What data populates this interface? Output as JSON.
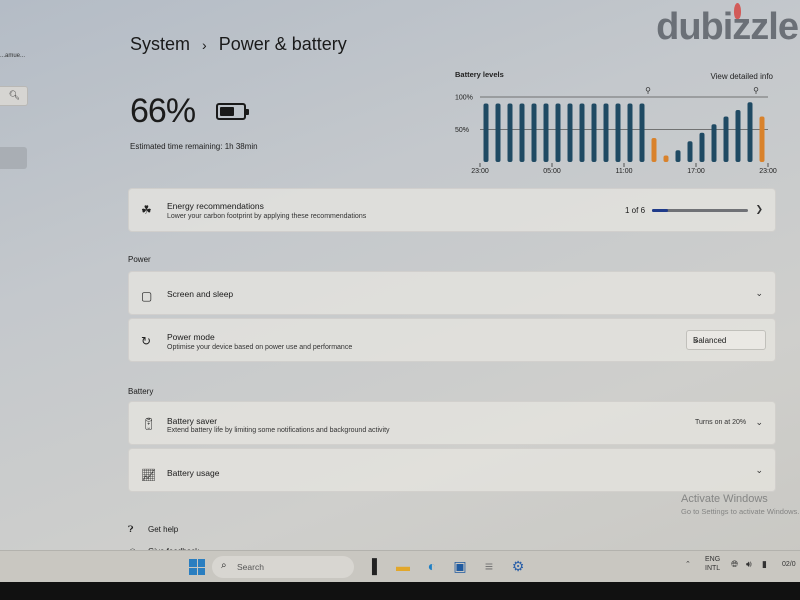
{
  "sidebar": {
    "user_email": "...amue...",
    "search_icon": "search-icon"
  },
  "watermark": "dubizzle",
  "breadcrumb": {
    "parent": "System",
    "separator": "›",
    "current": "Power & battery"
  },
  "battery": {
    "percent_label": "66%",
    "charge_fraction": 0.66,
    "estimate": "Estimated time remaining: 1h 38min"
  },
  "chart_data": {
    "type": "bar",
    "title": "Battery levels",
    "link": "View detailed info",
    "ylabel": "",
    "xlabel": "",
    "ylim": [
      0,
      100
    ],
    "yticks": [
      "100%",
      "50%"
    ],
    "ytick_values": [
      100,
      50
    ],
    "xticks": [
      "23:00",
      "05:00",
      "11:00",
      "17:00",
      "23:00"
    ],
    "xtick_positions": [
      0,
      6,
      12,
      18,
      24
    ],
    "grid": true,
    "categories": [
      "23:00",
      "00:00",
      "01:00",
      "02:00",
      "03:00",
      "04:00",
      "05:00",
      "06:00",
      "07:00",
      "08:00",
      "09:00",
      "10:00",
      "11:00",
      "12:00",
      "13:00",
      "14:00",
      "15:00",
      "16:00",
      "17:00",
      "18:00",
      "19:00",
      "20:00",
      "21:00",
      "22:00"
    ],
    "values": [
      90,
      90,
      90,
      90,
      90,
      90,
      90,
      90,
      90,
      90,
      90,
      90,
      90,
      90,
      37,
      10,
      18,
      32,
      45,
      58,
      70,
      80,
      92,
      70
    ],
    "status": [
      "battery",
      "battery",
      "battery",
      "battery",
      "battery",
      "battery",
      "battery",
      "battery",
      "battery",
      "battery",
      "battery",
      "battery",
      "battery",
      "battery",
      "saver",
      "saver",
      "battery",
      "battery",
      "battery",
      "battery",
      "battery",
      "battery",
      "battery",
      "saver"
    ],
    "plug_markers_at": [
      13.5,
      22.5
    ],
    "colors": {
      "battery": "#1f4a63",
      "saver": "#d9822b"
    }
  },
  "energy": {
    "title": "Energy recommendations",
    "subtitle": "Lower your carbon footprint by applying these recommendations",
    "count": "1 of 6",
    "progress_fraction": 0.1667,
    "accent": "#1f3b8a"
  },
  "sections": {
    "power": "Power",
    "battery": "Battery"
  },
  "screen_sleep": {
    "title": "Screen and sleep"
  },
  "power_mode": {
    "title": "Power mode",
    "subtitle": "Optimise your device based on power use and performance",
    "selected": "Balanced"
  },
  "battery_saver": {
    "title": "Battery saver",
    "subtitle": "Extend battery life by limiting some notifications and background activity",
    "value": "Turns on at 20%"
  },
  "battery_usage": {
    "title": "Battery usage"
  },
  "help": {
    "get_help": "Get help",
    "give_feedback": "Give feedback"
  },
  "activate": {
    "title": "Activate Windows",
    "subtitle": "Go to Settings to activate Windows."
  },
  "taskbar": {
    "search_label": "Search",
    "lang_top": "ENG",
    "lang_bottom": "INTL",
    "clock_partial": "02/0"
  }
}
